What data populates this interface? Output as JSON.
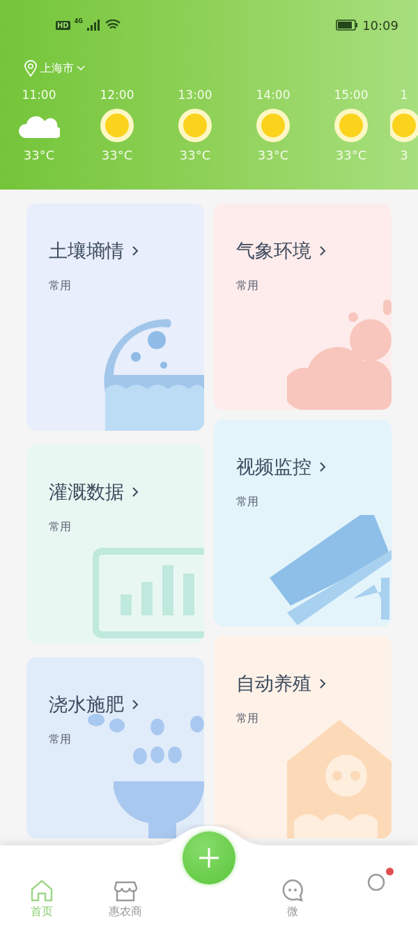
{
  "status_bar": {
    "hd": "HD",
    "network": "4G",
    "time": "10:09"
  },
  "location": {
    "city": "上海市"
  },
  "forecast": [
    {
      "time": "11:00",
      "kind": "cloudy",
      "temp": "33°C"
    },
    {
      "time": "12:00",
      "kind": "sunny",
      "temp": "33°C"
    },
    {
      "time": "13:00",
      "kind": "sunny",
      "temp": "33°C"
    },
    {
      "time": "14:00",
      "kind": "sunny",
      "temp": "33°C"
    },
    {
      "time": "15:00",
      "kind": "sunny",
      "temp": "33°C"
    },
    {
      "time": "1",
      "kind": "sunny",
      "temp": "3"
    }
  ],
  "cards": [
    {
      "title": "土壤墒情",
      "subtitle": "常用",
      "kind": "soil",
      "color": "#e8eefb"
    },
    {
      "title": "灌溉数据",
      "subtitle": "常用",
      "kind": "irrigation",
      "color": "#e9f7f2"
    },
    {
      "title": "浇水施肥",
      "subtitle": "常用",
      "kind": "watering",
      "color": "#e1ecfa"
    },
    {
      "title": "气象环境",
      "subtitle": "常用",
      "kind": "weather",
      "color": "#fdeceb"
    },
    {
      "title": "视频监控",
      "subtitle": "常用",
      "kind": "video",
      "color": "#e3f4fb"
    },
    {
      "title": "自动养殖",
      "subtitle": "常用",
      "kind": "breeding",
      "color": "#fdf1e8"
    }
  ],
  "tab_bar": [
    {
      "kind": "home",
      "label": "首页",
      "selected": true
    },
    {
      "kind": "shop",
      "label": "惠农商",
      "selected": false
    },
    {
      "kind": "add"
    },
    {
      "kind": "chat",
      "label": "微",
      "selected": false
    },
    {
      "kind": "profile",
      "selected": false
    }
  ]
}
